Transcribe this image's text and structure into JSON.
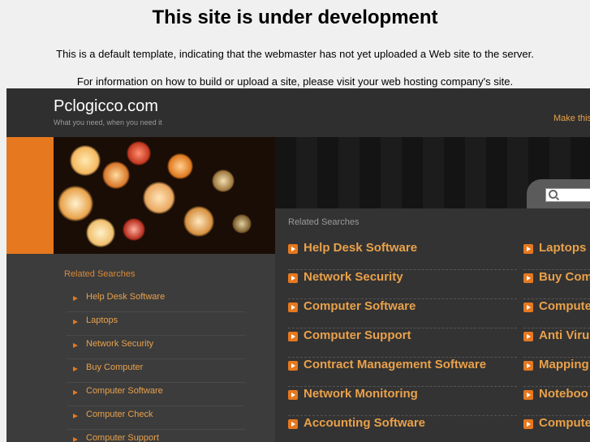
{
  "notice": {
    "title": "This site is under development",
    "line1": "This is a default template, indicating that the webmaster has not yet uploaded a Web site to the server.",
    "line2": "For information on how to build or upload a site, please visit your web hosting company's site."
  },
  "header": {
    "site_title": "Pclogicco.com",
    "tagline": "What you need, when you need it",
    "make_link": "Make this"
  },
  "search": {
    "icon": "search-icon",
    "placeholder": ""
  },
  "left": {
    "heading": "Related Searches",
    "items": [
      {
        "label": "Help Desk Software"
      },
      {
        "label": "Laptops"
      },
      {
        "label": "Network Security"
      },
      {
        "label": "Buy Computer"
      },
      {
        "label": "Computer Software"
      },
      {
        "label": "Computer Check"
      },
      {
        "label": "Computer Support"
      }
    ]
  },
  "main": {
    "heading": "Related Searches",
    "col1": [
      {
        "label": "Help Desk Software"
      },
      {
        "label": "Network Security"
      },
      {
        "label": "Computer Software"
      },
      {
        "label": "Computer Support"
      },
      {
        "label": "Contract Management Software"
      },
      {
        "label": "Network Monitoring"
      },
      {
        "label": "Accounting Software"
      }
    ],
    "col2": [
      {
        "label": "Laptops"
      },
      {
        "label": "Buy Com"
      },
      {
        "label": "Compute"
      },
      {
        "label": "Anti Virus"
      },
      {
        "label": "Mapping"
      },
      {
        "label": "Noteboo"
      },
      {
        "label": "Compute"
      }
    ]
  },
  "colors": {
    "accent": "#e6781f",
    "link": "#e9a14a",
    "bg": "#3a3a3a"
  }
}
